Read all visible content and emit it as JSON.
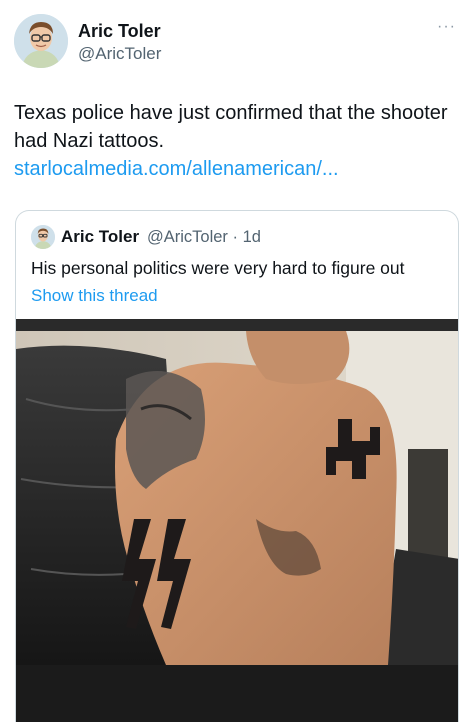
{
  "author": {
    "name": "Aric Toler",
    "handle": "@AricToler",
    "avatar_icon": "profile-photo"
  },
  "menu": {
    "more_label": "···"
  },
  "tweet": {
    "text": "Texas police have just confirmed that the shooter had Nazi tattoos.",
    "link": "starlocalmedia.com/allenamerican/..."
  },
  "quote": {
    "name": "Aric Toler",
    "handle_time": "@AricToler · 1d",
    "text": "His personal politics were very hard to figure out",
    "show_thread": "Show this thread"
  },
  "colors": {
    "link": "#1d9bf0",
    "secondary": "#536471",
    "border": "#cfd9de"
  }
}
